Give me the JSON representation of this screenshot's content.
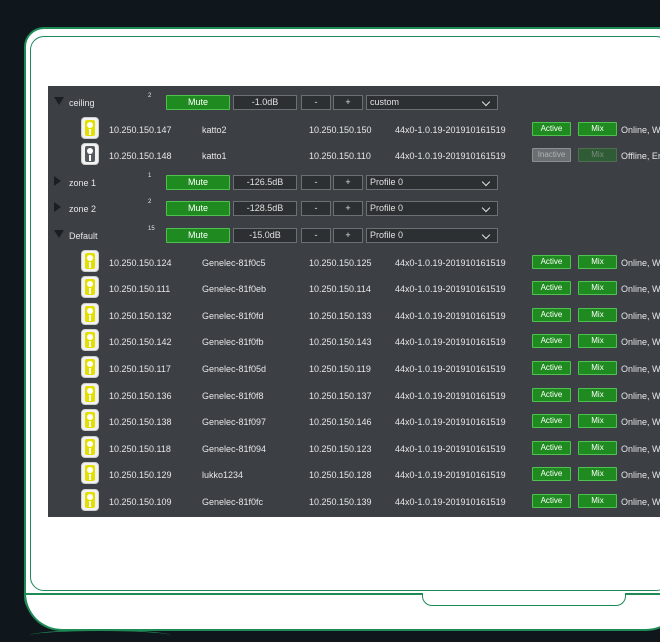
{
  "groups": [
    {
      "name": "ceiling",
      "count": "2",
      "expanded": true,
      "mute": "Mute",
      "volume": "-1.0dB",
      "minus": "-",
      "plus": "+",
      "profile": "custom",
      "devices": [
        {
          "ip": "10.250.150.147",
          "name": "katto2",
          "ip2": "10.250.150.150",
          "fw": "44x0-1.0.19-201910161519",
          "state": "Active",
          "mix": "Mix",
          "status": "Online, W",
          "online": true
        },
        {
          "ip": "10.250.150.148",
          "name": "katto1",
          "ip2": "10.250.150.110",
          "fw": "44x0-1.0.19-201910161519",
          "state": "Inactive",
          "mix": "Mix",
          "status": "Offline, Er",
          "online": false
        }
      ]
    },
    {
      "name": "zone 1",
      "count": "1",
      "expanded": false,
      "mute": "Mute",
      "volume": "-126.5dB",
      "minus": "-",
      "plus": "+",
      "profile": "Profile 0",
      "devices": []
    },
    {
      "name": "zone 2",
      "count": "2",
      "expanded": false,
      "mute": "Mute",
      "volume": "-128.5dB",
      "minus": "-",
      "plus": "+",
      "profile": "Profile 0",
      "devices": []
    },
    {
      "name": "Default",
      "count": "15",
      "expanded": true,
      "mute": "Mute",
      "volume": "-15.0dB",
      "minus": "-",
      "plus": "+",
      "profile": "Profile 0",
      "devices": [
        {
          "ip": "10.250.150.124",
          "name": "Genelec-81f0c5",
          "ip2": "10.250.150.125",
          "fw": "44x0-1.0.19-201910161519",
          "state": "Active",
          "mix": "Mix",
          "status": "Online, W",
          "online": true
        },
        {
          "ip": "10.250.150.111",
          "name": "Genelec-81f0eb",
          "ip2": "10.250.150.114",
          "fw": "44x0-1.0.19-201910161519",
          "state": "Active",
          "mix": "Mix",
          "status": "Online, W",
          "online": true
        },
        {
          "ip": "10.250.150.132",
          "name": "Genelec-81f0fd",
          "ip2": "10.250.150.133",
          "fw": "44x0-1.0.19-201910161519",
          "state": "Active",
          "mix": "Mix",
          "status": "Online, W",
          "online": true
        },
        {
          "ip": "10.250.150.142",
          "name": "Genelec-81f0fb",
          "ip2": "10.250.150.143",
          "fw": "44x0-1.0.19-201910161519",
          "state": "Active",
          "mix": "Mix",
          "status": "Online, W",
          "online": true
        },
        {
          "ip": "10.250.150.117",
          "name": "Genelec-81f05d",
          "ip2": "10.250.150.119",
          "fw": "44x0-1.0.19-201910161519",
          "state": "Active",
          "mix": "Mix",
          "status": "Online, W",
          "online": true
        },
        {
          "ip": "10.250.150.136",
          "name": "Genelec-81f0f8",
          "ip2": "10.250.150.137",
          "fw": "44x0-1.0.19-201910161519",
          "state": "Active",
          "mix": "Mix",
          "status": "Online, W",
          "online": true
        },
        {
          "ip": "10.250.150.138",
          "name": "Genelec-81f097",
          "ip2": "10.250.150.146",
          "fw": "44x0-1.0.19-201910161519",
          "state": "Active",
          "mix": "Mix",
          "status": "Online, W",
          "online": true
        },
        {
          "ip": "10.250.150.118",
          "name": "Genelec-81f094",
          "ip2": "10.250.150.123",
          "fw": "44x0-1.0.19-201910161519",
          "state": "Active",
          "mix": "Mix",
          "status": "Online, W",
          "online": true
        },
        {
          "ip": "10.250.150.129",
          "name": "lukko1234",
          "ip2": "10.250.150.128",
          "fw": "44x0-1.0.19-201910161519",
          "state": "Active",
          "mix": "Mix",
          "status": "Online, W",
          "online": true
        },
        {
          "ip": "10.250.150.109",
          "name": "Genelec-81f0fc",
          "ip2": "10.250.150.139",
          "fw": "44x0-1.0.19-201910161519",
          "state": "Active",
          "mix": "Mix",
          "status": "Online, W",
          "online": true
        }
      ]
    }
  ],
  "colors": {
    "accent": "#1f8a1f",
    "panel": "#3c4045",
    "frame": "#1e8a55",
    "speaker": "#e3e000"
  }
}
